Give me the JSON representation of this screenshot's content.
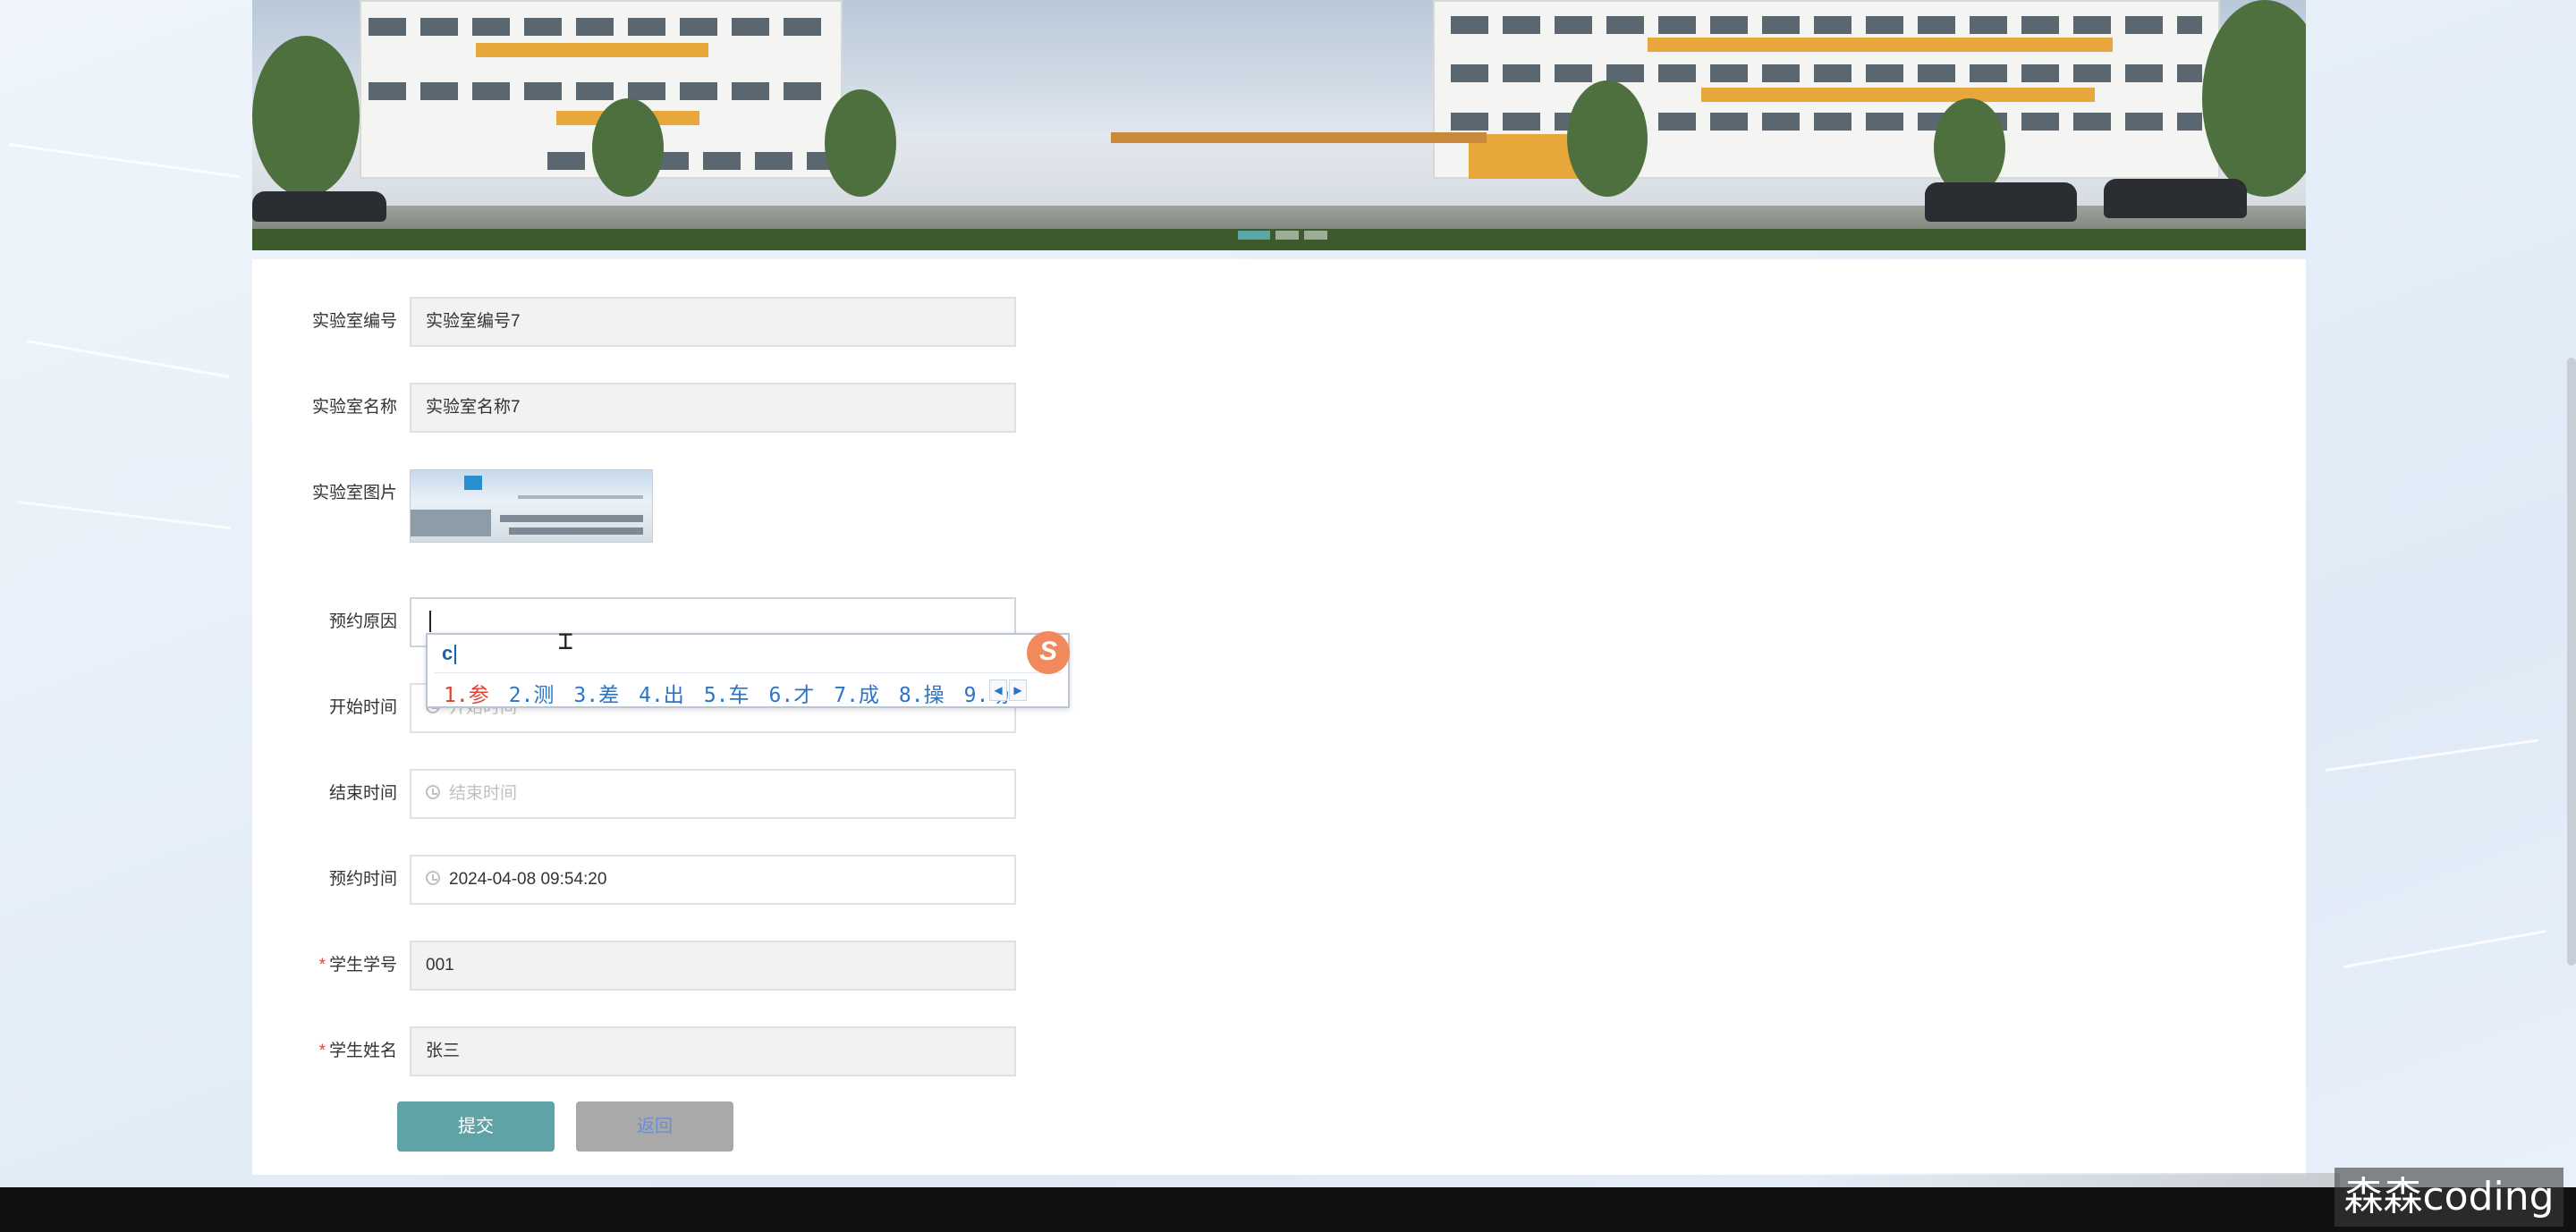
{
  "form": {
    "fields": [
      {
        "label": "实验室编号",
        "value": "实验室编号7",
        "required": false
      },
      {
        "label": "实验室名称",
        "value": "实验室名称7",
        "required": false
      },
      {
        "label": "实验室图片",
        "required": false
      },
      {
        "label": "预约原因",
        "value": "",
        "required": false
      },
      {
        "label": "开始时间",
        "placeholder": "开始时间",
        "required": false
      },
      {
        "label": "结束时间",
        "placeholder": "结束时间",
        "required": false
      },
      {
        "label": "预约时间",
        "value": "2024-04-08 09:54:20",
        "required": false
      },
      {
        "label": "学生学号",
        "value": "001",
        "required": true
      },
      {
        "label": "学生姓名",
        "value": "张三",
        "required": true
      }
    ],
    "required_mark": "*",
    "submit_label": "提交",
    "back_label": "返回"
  },
  "ime": {
    "input": "c",
    "candidates": [
      "1.参",
      "2.测",
      "3.差",
      "4.出",
      "5.车",
      "6.才",
      "7.成",
      "8.操",
      "9.场"
    ],
    "logo": "S",
    "prev_icon": "triangle-left",
    "next_icon": "triangle-right"
  },
  "carousel": {
    "slides": 3,
    "active": 0
  },
  "watermark": "森森coding",
  "colors": {
    "submit": "#5fa3a7",
    "back": "#a9a9a9",
    "required": "#e04040",
    "ime_candidate": "#2a74c9",
    "ime_first": "#e04030"
  }
}
